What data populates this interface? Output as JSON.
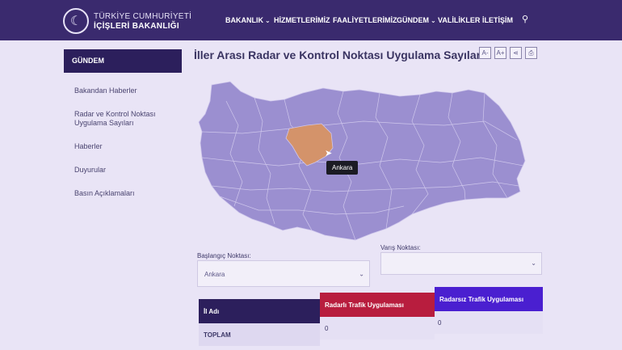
{
  "header": {
    "logo_line1": "TÜRKİYE CUMHURİYETİ",
    "logo_line2": "İÇİŞLERİ BAKANLIĞI",
    "nav": [
      {
        "label": "BAKANLIK",
        "dropdown": true
      },
      {
        "label": "HİZMETLERİMİZ",
        "dropdown": false
      },
      {
        "label": "FAALİYETLERİMİZ",
        "dropdown": false
      },
      {
        "label": "GÜNDEM",
        "dropdown": true
      },
      {
        "label": "VALİLİKLER",
        "dropdown": false
      },
      {
        "label": "İLETİŞİM",
        "dropdown": false
      }
    ],
    "search_icon": "search-icon"
  },
  "sidebar": {
    "heading": "GÜNDEM",
    "items": [
      {
        "label": "Bakandan Haberler"
      },
      {
        "label": "Radar ve Kontrol Noktası Uygulama Sayıları"
      },
      {
        "label": "Haberler"
      },
      {
        "label": "Duyurular"
      },
      {
        "label": "Basın Açıklamaları"
      }
    ]
  },
  "main": {
    "title": "İller Arası Radar ve Kontrol Noktası Uygulama Sayıları",
    "tools": [
      {
        "label": "A-",
        "icon": "font-decrease-icon"
      },
      {
        "label": "A+",
        "icon": "font-increase-icon"
      },
      {
        "label": "⋖",
        "icon": "share-icon"
      },
      {
        "label": "⎙",
        "icon": "print-icon"
      }
    ],
    "map": {
      "tooltip": "Ankara",
      "selected_province": "Ankara",
      "colors": {
        "province": "#9b8fd0",
        "selected": "#d4936a",
        "border": "#cfc7ec"
      }
    },
    "start_label": "Başlangıç Noktası:",
    "start_value": "Ankara",
    "end_label": "Varış Noktası:",
    "end_value": "",
    "table": {
      "headers": [
        {
          "label": "İl Adı",
          "color": "#2c1f5c"
        },
        {
          "label": "Radarlı Trafik Uygulaması",
          "color": "#b81d3e"
        },
        {
          "label": "Radarsız Trafik Uygulaması",
          "color": "#4a1fd0"
        }
      ],
      "rows": [
        {
          "name": "TOPLAM",
          "radarli": "0",
          "radarsiz": "0"
        }
      ]
    }
  }
}
